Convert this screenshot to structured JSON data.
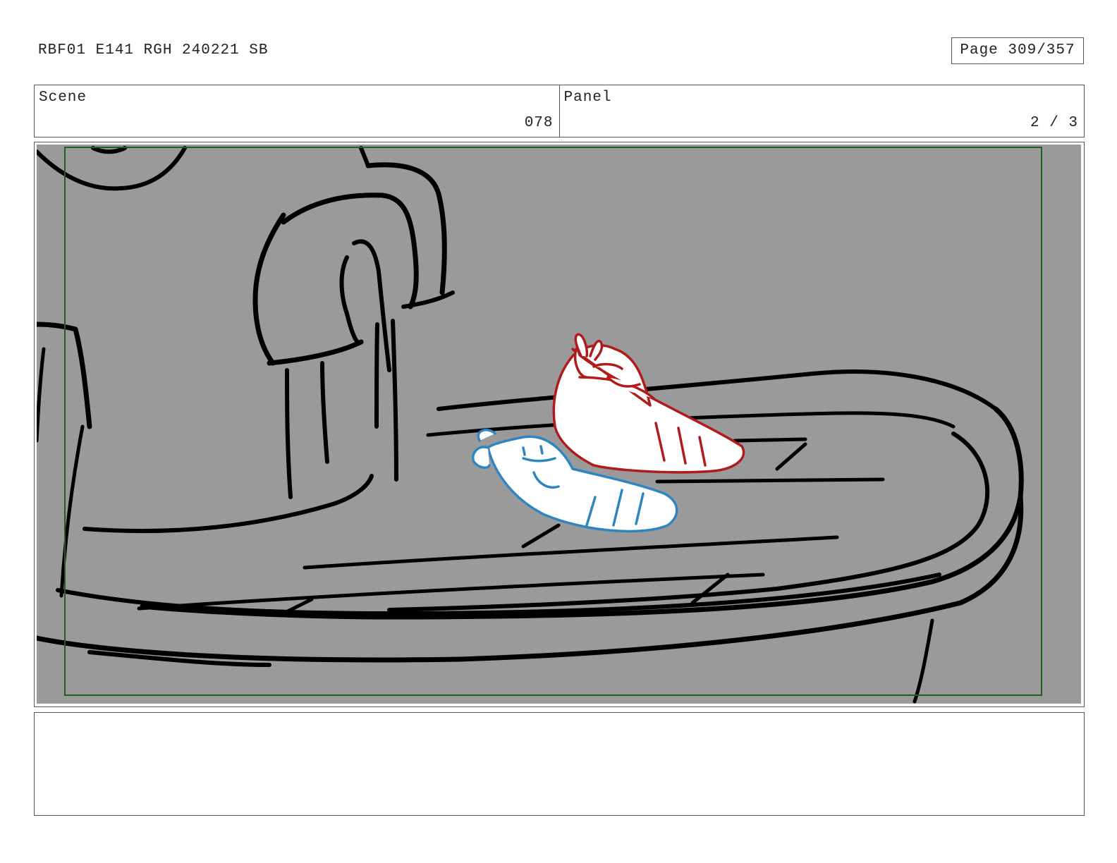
{
  "header": {
    "doc_title": "RBF01 E141 RGH 240221 SB",
    "page_label": "Page 309/357"
  },
  "info": {
    "scene_label": "Scene",
    "scene_value": "078",
    "panel_label": "Panel",
    "panel_value": "2 / 3"
  },
  "panel": {
    "background_color": "#9a9a9a",
    "safe_frame_color": "#1f5f1f",
    "character_red_color": "#b01c1c",
    "character_blue_color": "#2e86c1"
  },
  "notes": {
    "text": ""
  }
}
